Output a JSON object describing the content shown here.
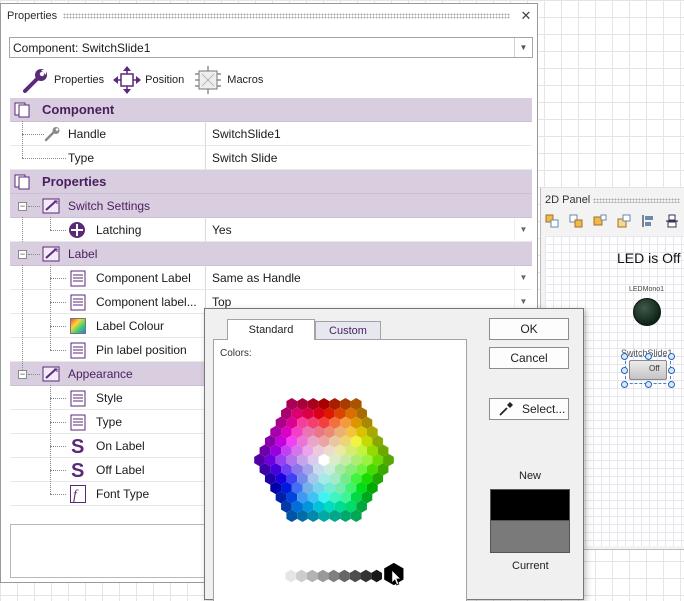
{
  "properties": {
    "title": "Properties",
    "component_select": "Component: SwitchSlide1",
    "tabs": [
      {
        "label": "Properties",
        "icon": "wrench-icon"
      },
      {
        "label": "Position",
        "icon": "move-arrows-icon"
      },
      {
        "label": "Macros",
        "icon": "macro-icon"
      }
    ],
    "rows": {
      "component": "Component",
      "handle": {
        "name": "Handle",
        "value": "SwitchSlide1"
      },
      "type": {
        "name": "Type",
        "value": "Switch Slide"
      },
      "properties": "Properties",
      "switch_settings": "Switch Settings",
      "latching": {
        "name": "Latching",
        "value": "Yes"
      },
      "label": "Label",
      "component_label": {
        "name": "Component Label",
        "value": "Same as Handle"
      },
      "component_label_pos": {
        "name": "Component label...",
        "value": "Top"
      },
      "label_colour": {
        "name": "Label Colour"
      },
      "pin_label_position": {
        "name": "Pin label position"
      },
      "appearance": "Appearance",
      "style": {
        "name": "Style"
      },
      "type2": {
        "name": "Type"
      },
      "on_label": {
        "name": "On Label"
      },
      "off_label": {
        "name": "Off Label"
      },
      "font_type": {
        "name": "Font Type"
      }
    }
  },
  "panel2d": {
    "title": "2D Panel",
    "led_text": "LED is Off",
    "led_name": "LEDMono1",
    "switch_name": "SwitchSlide1",
    "switch_state": "Off",
    "led_color": "#1a3324"
  },
  "color_dialog": {
    "tabs": [
      "Standard",
      "Custom"
    ],
    "colors_label": "Colors:",
    "ok": "OK",
    "cancel": "Cancel",
    "select": "Select...",
    "new_label": "New",
    "current_label": "Current",
    "new_color": "#000000",
    "current_color": "#7a7a7a"
  }
}
